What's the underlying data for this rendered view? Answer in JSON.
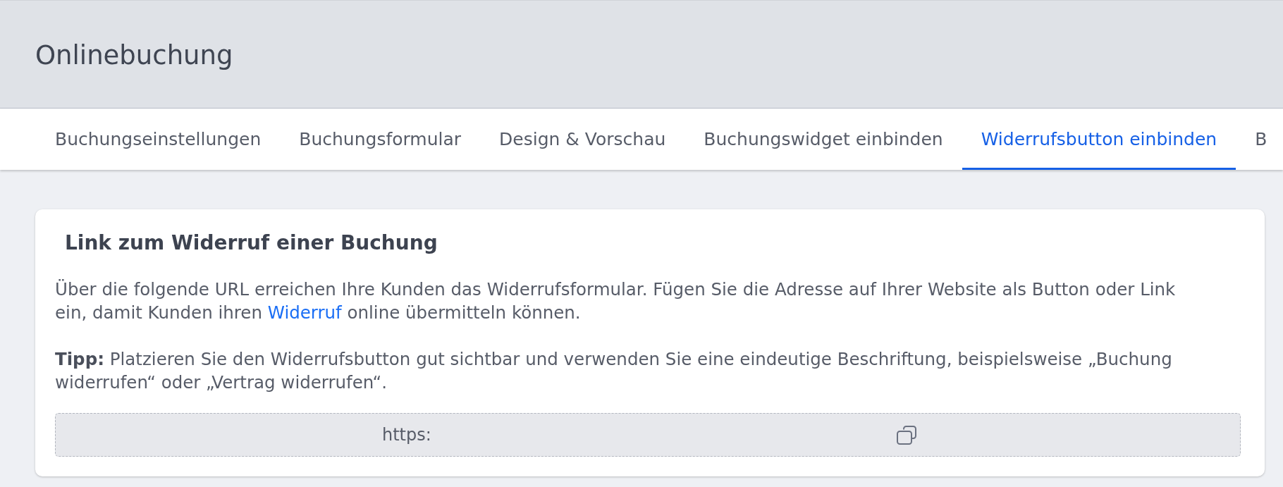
{
  "header": {
    "title": "Onlinebuchung"
  },
  "tabs": [
    {
      "label": "Buchungseinstellungen",
      "selected": false
    },
    {
      "label": "Buchungsformular",
      "selected": false
    },
    {
      "label": "Design & Vorschau",
      "selected": false
    },
    {
      "label": "Buchungswidget einbinden",
      "selected": false
    },
    {
      "label": "Widerrufsbutton einbinden",
      "selected": true
    },
    {
      "label": "B",
      "selected": false
    }
  ],
  "card": {
    "title": "Link zum Widerruf einer Buchung",
    "intro": {
      "before": "Über die folgende URL erreichen Ihre Kunden das Widerrufsformular. Fügen Sie die Adresse auf Ihrer Website als Button oder Link ein, damit Kunden ihren ",
      "link": "Widerruf",
      "after": " online übermitteln können."
    },
    "tip": "**Tipp:** Platzieren Sie den Widerrufsbutton gut sichtbar und verwenden Sie eine eindeutige Beschriftung, beispielsweise „Buchung widerrufen“ oder „Vertrag widerrufen“.",
    "url_field": {
      "value": "https:"
    }
  }
}
